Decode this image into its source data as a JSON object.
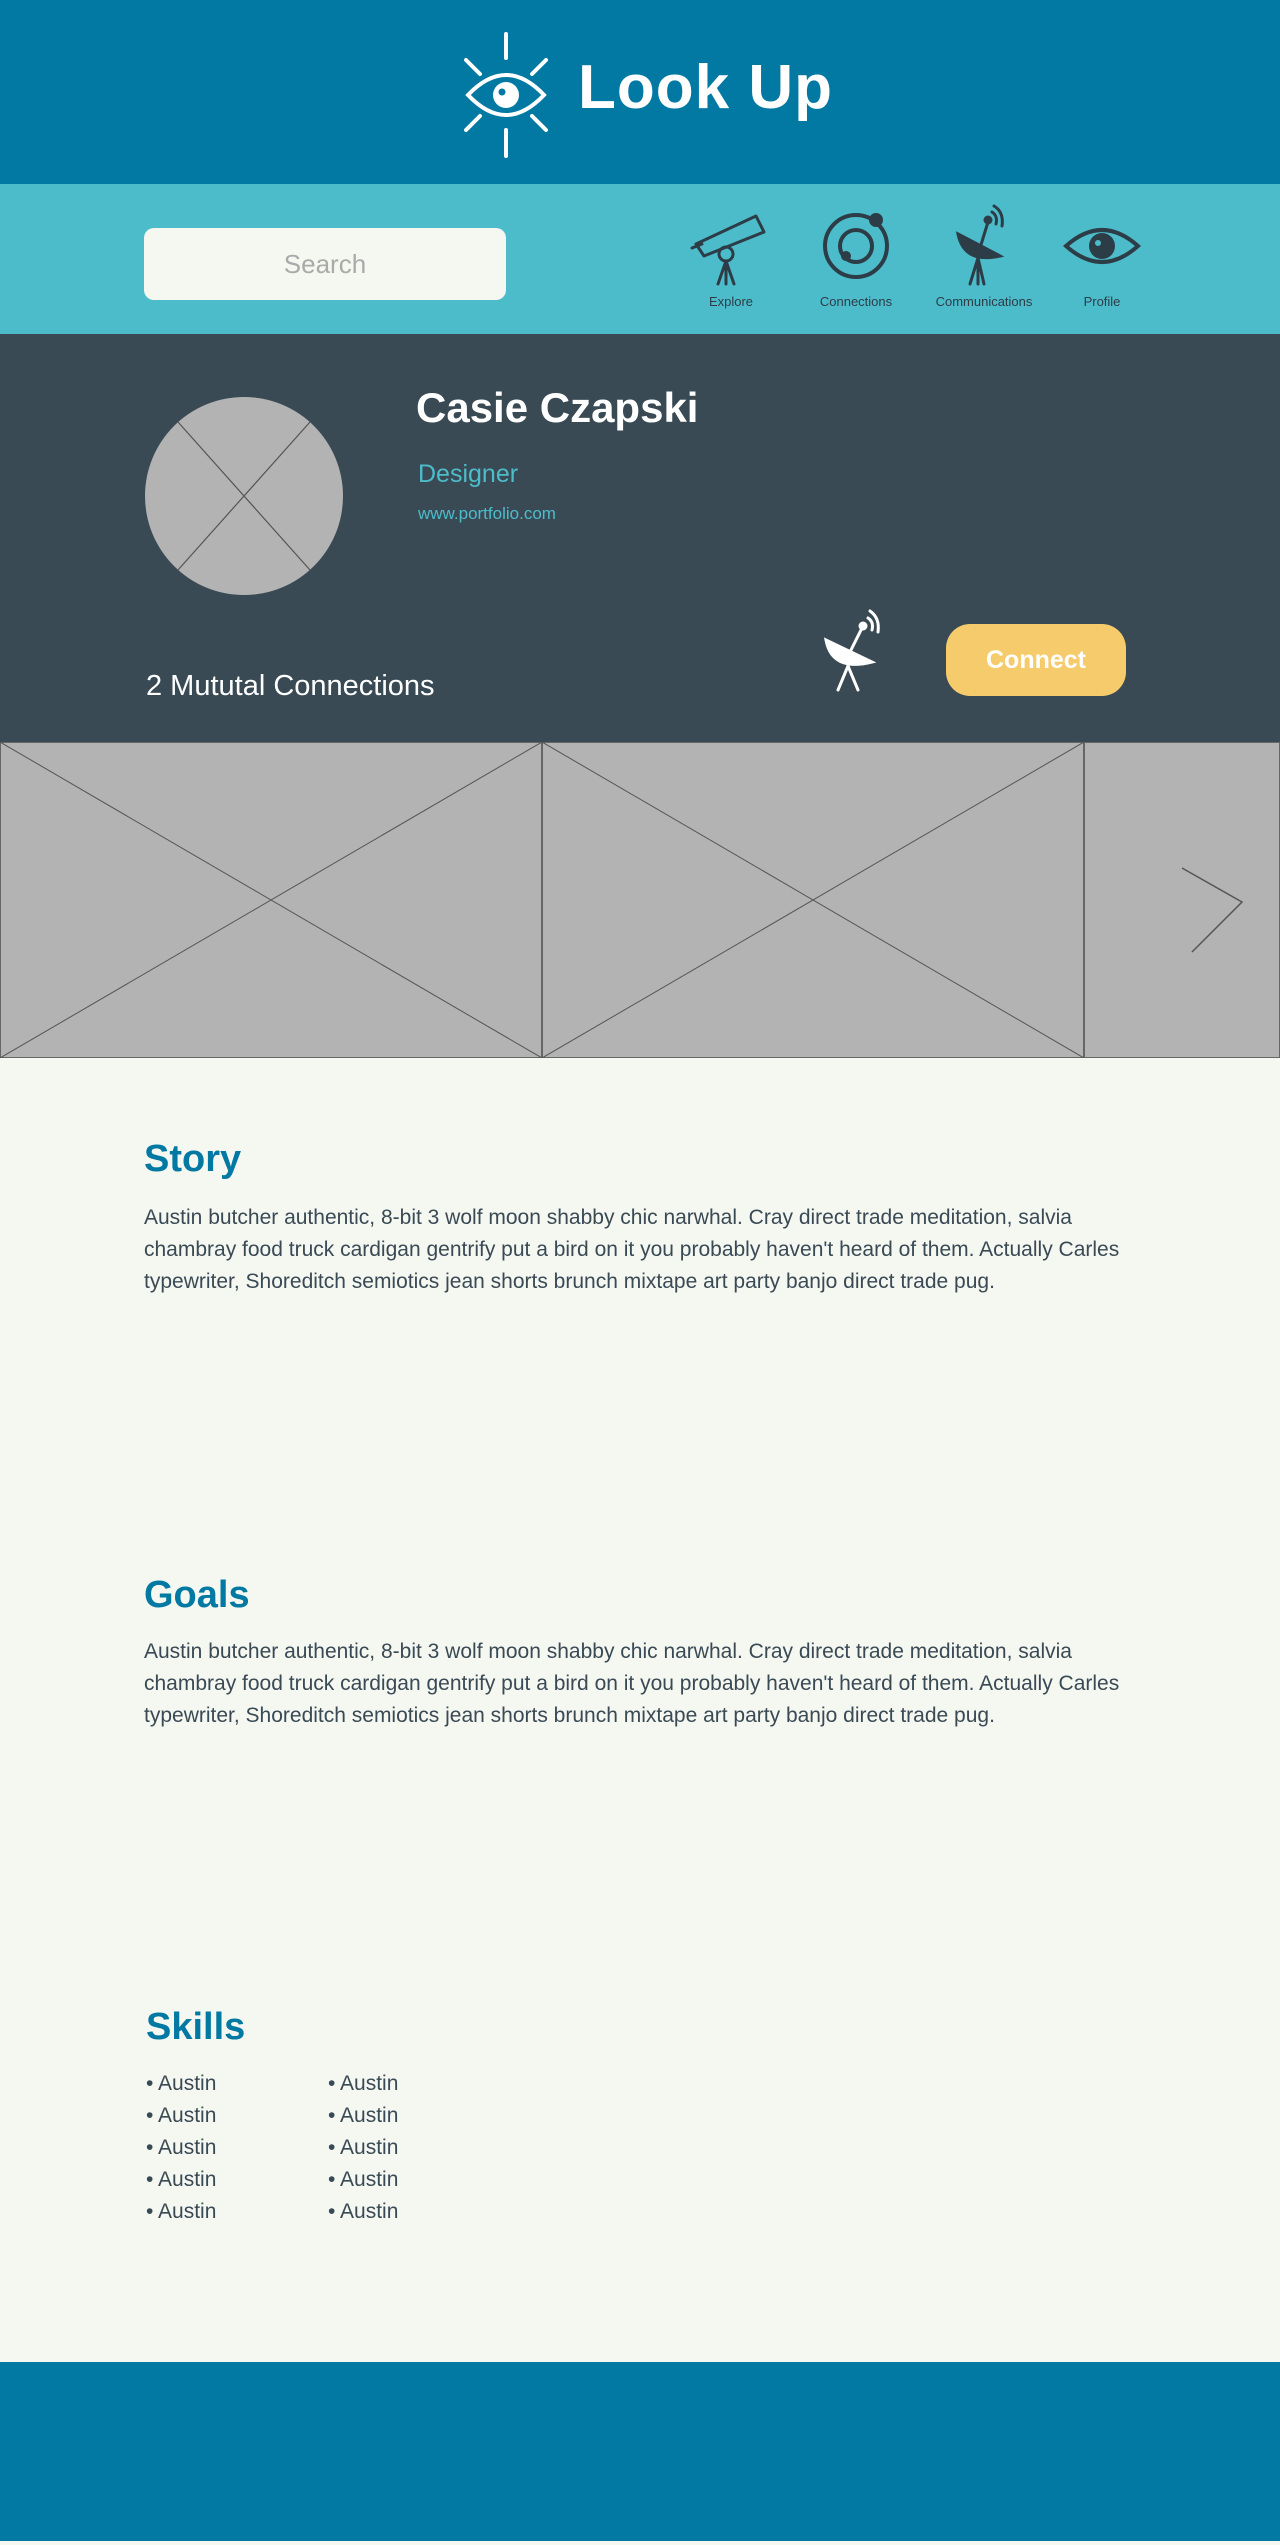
{
  "app": {
    "title": "Look Up"
  },
  "navbar": {
    "search_placeholder": "Search",
    "items": [
      {
        "label": "Explore",
        "icon": "telescope-icon"
      },
      {
        "label": "Connections",
        "icon": "orbit-icon"
      },
      {
        "label": "Communications",
        "icon": "satellite-dish-icon"
      },
      {
        "label": "Profile",
        "icon": "eye-icon"
      }
    ]
  },
  "profile": {
    "name": "Casie Czapski",
    "role": "Designer",
    "website": "www.portfolio.com",
    "mutual_connections": "2 Mututal Connections",
    "connect_label": "Connect"
  },
  "story": {
    "title": "Story",
    "body": "Austin butcher authentic, 8-bit 3 wolf moon shabby chic narwhal. Cray direct trade meditation, salvia chambray food truck cardigan gentrify put a bird on it you probably haven't heard of them. Actually Carles typewriter, Shoreditch semiotics jean shorts brunch mixtape art party banjo direct trade pug."
  },
  "goals": {
    "title": "Goals",
    "body": "Austin butcher authentic, 8-bit 3 wolf moon shabby chic narwhal. Cray direct trade meditation, salvia chambray food truck cardigan gentrify put a bird on it you probably haven't heard of them. Actually Carles typewriter, Shoreditch semiotics jean shorts brunch mixtape art party banjo direct trade pug."
  },
  "skills": {
    "title": "Skills",
    "column1": [
      "• Austin",
      "• Austin",
      "• Austin",
      "• Austin",
      "• Austin"
    ],
    "column2": [
      "• Austin",
      "• Austin",
      "• Austin",
      "• Austin",
      "• Austin"
    ]
  },
  "colors": {
    "primary": "#0279a3",
    "secondary": "#4dbcca",
    "dark": "#394a54",
    "accent": "#f6cb6b",
    "background": "#f5f7f1"
  }
}
